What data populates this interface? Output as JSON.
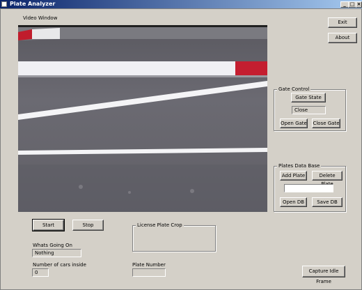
{
  "window": {
    "title": "Plate Analyzer"
  },
  "video": {
    "label": "Video Window"
  },
  "buttons": {
    "exit": "Exit",
    "about": "About",
    "start": "Start",
    "stop": "Stop",
    "capture": "Capture Idle Frame"
  },
  "gate": {
    "title": "Gate Control",
    "state_button": "Gate State",
    "state_value": "Close",
    "open": "Open Gate",
    "close": "Close Gate"
  },
  "db": {
    "title": "Plates Data Base",
    "add": "Add Plate",
    "delete": "Delete Plate",
    "plate_input": "",
    "open": "Open DB",
    "save": "Save DB"
  },
  "crop": {
    "title": "License Plate Crop"
  },
  "status": {
    "whats_label": "Whats Going On",
    "whats_value": "Nothing",
    "cars_label": "Number of cars inside",
    "cars_value": "0",
    "plate_label": "Plate Number",
    "plate_value": ""
  }
}
